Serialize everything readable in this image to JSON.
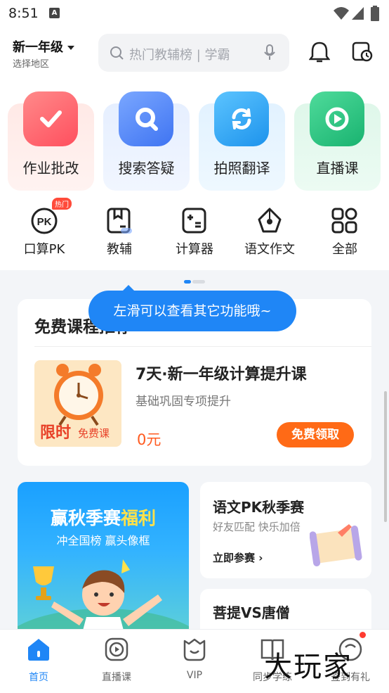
{
  "status": {
    "time": "8:51",
    "a_icon": "A"
  },
  "header": {
    "grade": "新一年级",
    "region": "选择地区",
    "search_placeholder": "热门教辅榜 | 学霸"
  },
  "big_features": [
    {
      "label": "作业批改",
      "icon": "check-icon",
      "color": "#ff5f68"
    },
    {
      "label": "搜索答疑",
      "icon": "search-q-icon",
      "color": "#4f86f7"
    },
    {
      "label": "拍照翻译",
      "icon": "refresh-icon",
      "color": "#2fa8f0"
    },
    {
      "label": "直播课",
      "icon": "play-tv-icon",
      "color": "#2bbf7e"
    }
  ],
  "small_features": [
    {
      "label": "口算PK",
      "badge": "热门"
    },
    {
      "label": "教辅"
    },
    {
      "label": "计算器"
    },
    {
      "label": "语文作文"
    },
    {
      "label": "全部"
    }
  ],
  "tooltip": "左滑可以查看其它功能哦~",
  "free_course": {
    "section_title": "免费课程推荐",
    "title": "7天·新一年级计算提升课",
    "subtitle": "基础巩固专项提升",
    "price": "0元",
    "claim_label": "免费领取",
    "image_limited": "限时",
    "image_free": "免费课"
  },
  "promo": {
    "title_white": "赢秋季赛",
    "title_yellow": "福利",
    "subtitle": "冲全国榜 赢头像框"
  },
  "pk_card": {
    "title": "语文PK秋季赛",
    "subtitle": "好友匹配 快乐加倍",
    "action": "立即参赛"
  },
  "tang_card": {
    "title": "菩提VS唐僧"
  },
  "tabs": [
    {
      "label": "首页",
      "active": true
    },
    {
      "label": "直播课"
    },
    {
      "label": "VIP"
    },
    {
      "label": "同步学练"
    },
    {
      "label": "签到有礼"
    }
  ],
  "watermark": "大玩家",
  "colors": {
    "accent": "#1f86f6",
    "orange": "#ff6a16"
  }
}
